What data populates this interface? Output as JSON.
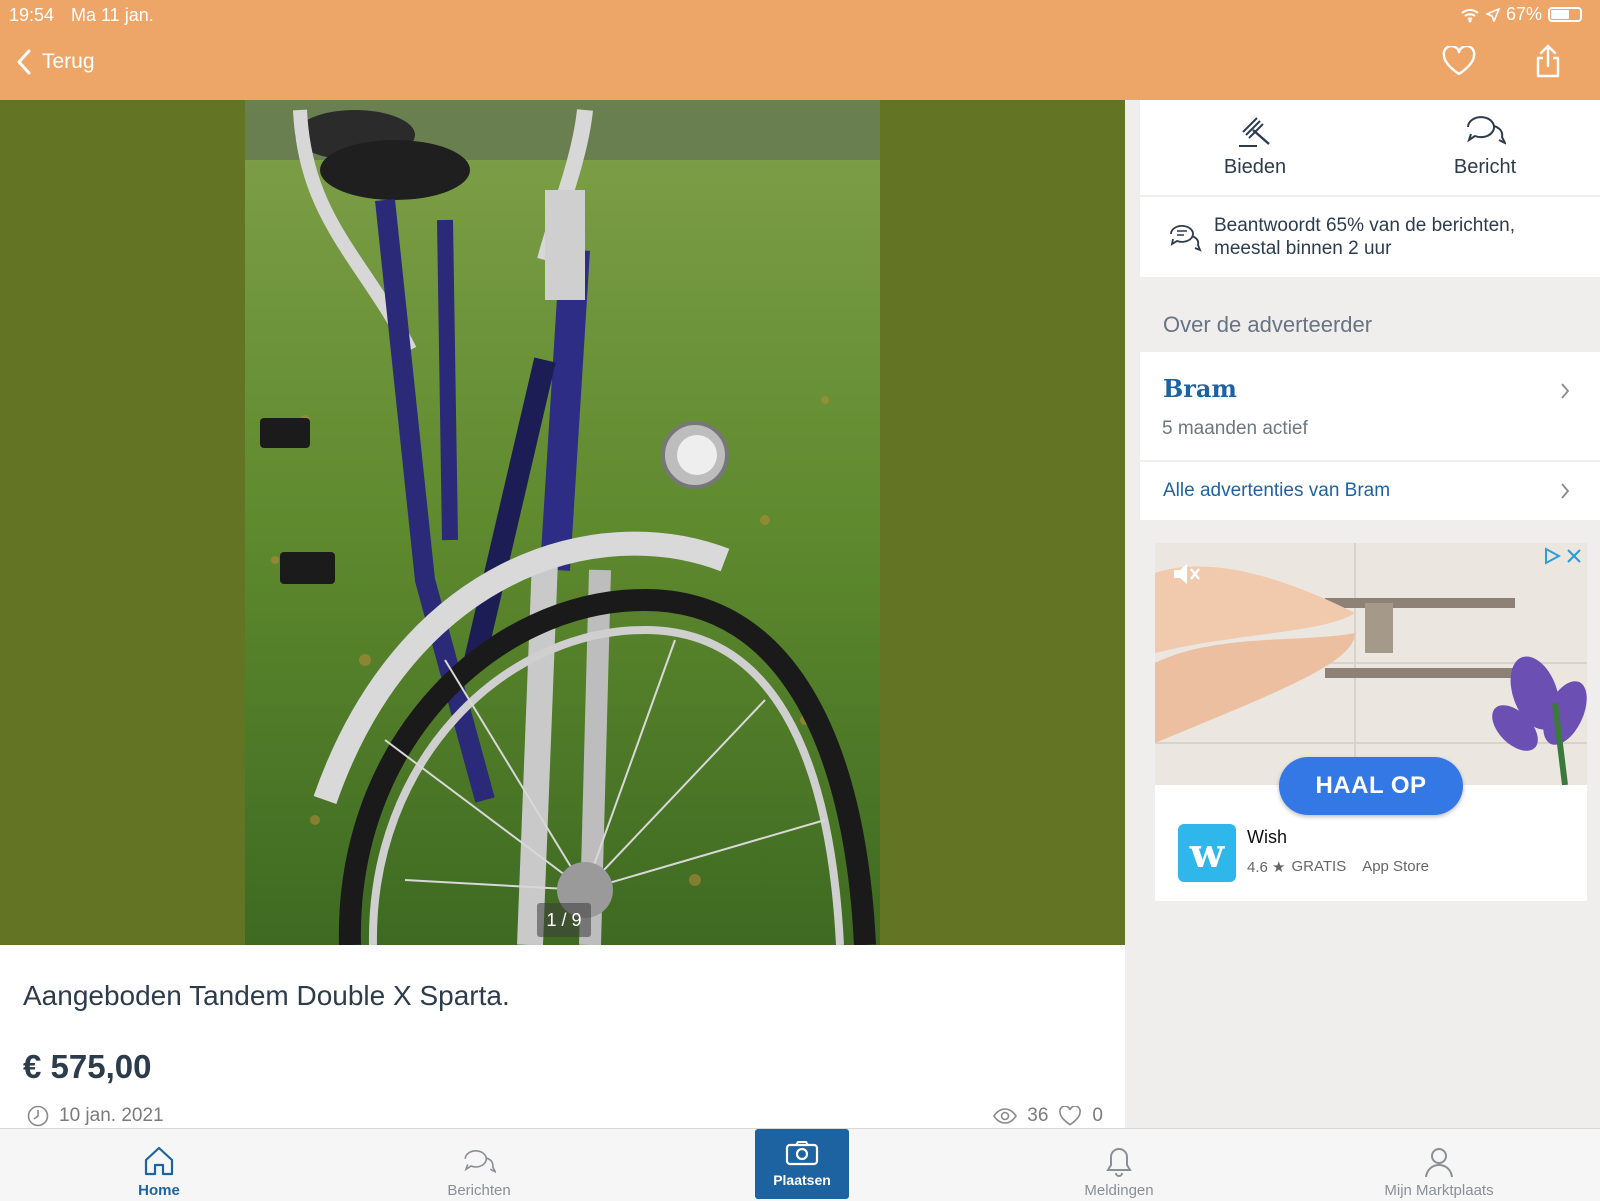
{
  "status_bar": {
    "time": "19:54",
    "date": "Ma 11 jan.",
    "battery": "67%"
  },
  "header": {
    "back_label": "Terug",
    "icons": [
      "heart-icon",
      "share-icon"
    ]
  },
  "gallery": {
    "counter": "1 / 9",
    "current": 1,
    "total": 9
  },
  "listing": {
    "title": "Aangeboden Tandem Double X Sparta.",
    "price": "€ 575,00",
    "date": "10 jan. 2021",
    "views": "36",
    "favorites": "0"
  },
  "actions": {
    "bid_label": "Bieden",
    "message_label": "Bericht"
  },
  "response": {
    "line1": "Beantwoordt 65% van de berichten,",
    "line2": "meestal binnen 2 uur"
  },
  "seller": {
    "heading": "Over de adverteerder",
    "name": "Bram",
    "active": "5 maanden actief",
    "all_ads": "Alle advertenties van Bram"
  },
  "ad": {
    "cta": "HAAL OP",
    "app_name": "Wish",
    "app_logo": "w",
    "rating": "4.6 ★",
    "price": "GRATIS",
    "store": "App Store"
  },
  "tabs": {
    "home": "Home",
    "messages": "Berichten",
    "post": "Plaatsen",
    "notifications": "Meldingen",
    "account": "Mijn Marktplaats"
  },
  "colors": {
    "header": "#eea668",
    "brand_blue": "#1d63a1",
    "gallery_bg": "#637425",
    "ad_cta": "#3478e6"
  }
}
